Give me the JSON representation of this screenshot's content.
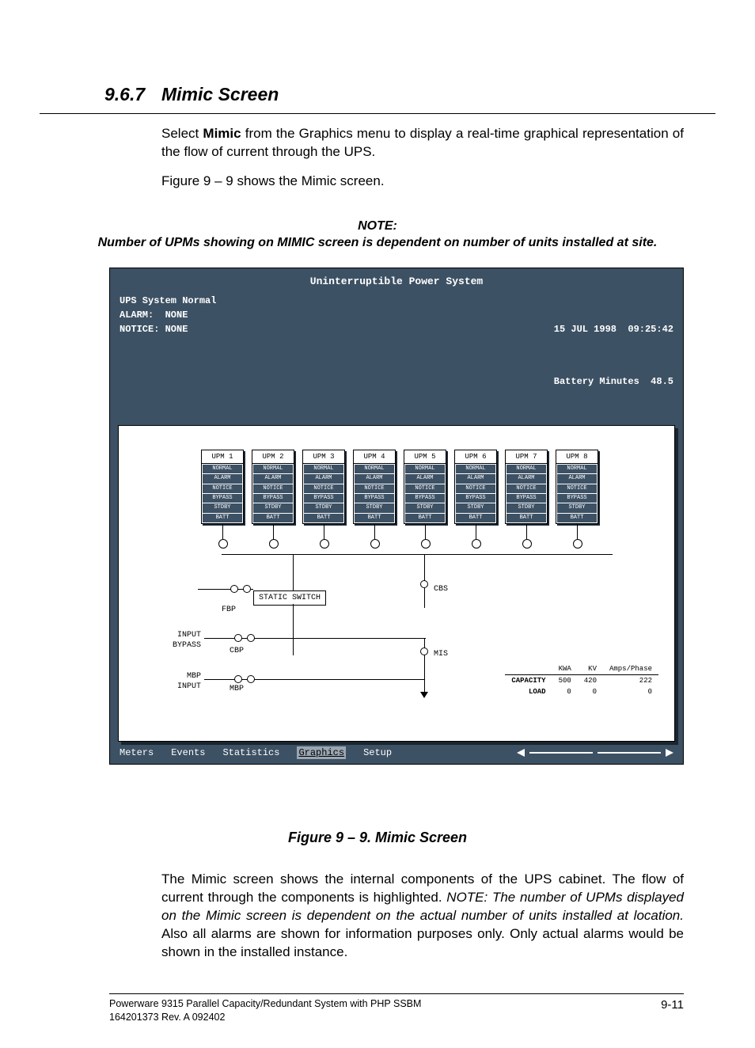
{
  "heading": {
    "number": "9.6.7",
    "title": "Mimic Screen"
  },
  "intro": {
    "p1_a": "Select ",
    "p1_b": "Mimic",
    "p1_c": " from the Graphics menu to display a real-time graphical representation of the flow of current through the UPS.",
    "p2": "Figure 9 – 9 shows the Mimic screen."
  },
  "note": {
    "label": "NOTE:",
    "text": "Number of UPMs showing on MIMIC screen is dependent on number of units installed at site."
  },
  "screen": {
    "title": "Uninterruptible Power System",
    "status_left": "UPS System Normal\nALARM:  NONE\nNOTICE: NONE",
    "status_right_1": "15 JUL 1998  09:25:42",
    "status_right_2": "Battery Minutes  48.5",
    "upms": [
      "UPM 1",
      "UPM 2",
      "UPM 3",
      "UPM 4",
      "UPM 5",
      "UPM 6",
      "UPM 7",
      "UPM 8"
    ],
    "upm_rows": [
      "NORMAL",
      "ALARM",
      "NOTICE",
      "BYPASS",
      "STDBY",
      "BATT"
    ],
    "labels": {
      "cbs": "CBS",
      "static_switch": "STATIC SWITCH",
      "fbp": "FBP",
      "input_bypass": "INPUT\nBYPASS",
      "cbp": "CBP",
      "mis": "MIS",
      "mbp_input": "MBP\nINPUT",
      "mbp": "MBP"
    },
    "cap_table": {
      "headers": [
        "",
        "KWA",
        "KV",
        "Amps/Phase"
      ],
      "rows": [
        [
          "CAPACITY",
          "500",
          "420",
          "222"
        ],
        [
          "LOAD",
          "0",
          "0",
          "0"
        ]
      ]
    },
    "menu": [
      "Meters",
      "Events",
      "Statistics",
      "Graphics",
      "Setup"
    ],
    "menu_active": "Graphics"
  },
  "caption": "Figure 9 – 9.   Mimic Screen",
  "closing": {
    "p1_a": "The Mimic screen shows the internal components of the UPS cabinet.  The flow of current through the components is highlighted. ",
    "p1_note": "NOTE: The number of UPMs displayed on the Mimic screen is dependent on the actual number of units installed at location.",
    "p1_c": " Also all alarms are shown for information purposes only. Only actual alarms would be shown in the installed instance."
  },
  "footer": {
    "left1": "Powerware 9315 Parallel Capacity/Redundant System with PHP SSBM",
    "left2": "164201373   Rev. A     092402",
    "page": "9-11"
  }
}
